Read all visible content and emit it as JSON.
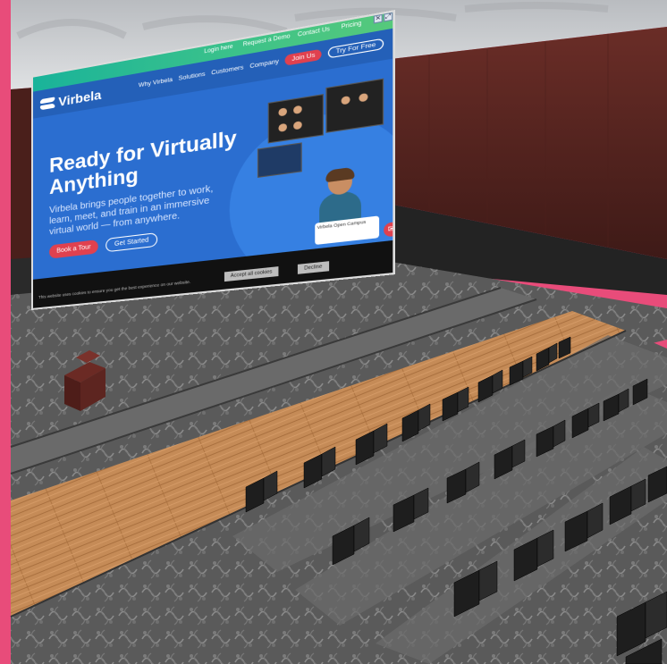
{
  "app": {
    "border_color": "#e84c7a"
  },
  "screen": {
    "topbar_items": [
      "Login here",
      "Request a Demo",
      "Contact Us",
      "Pricing"
    ],
    "logo_text": "Virbela",
    "nav": {
      "links": [
        "Why Virbela",
        "Solutions",
        "Customers",
        "Company"
      ],
      "red_button": "Join Us",
      "outline_button": "Try For Free"
    },
    "hero": {
      "title_line1": "Ready for Virtually",
      "title_line2": "Anything",
      "subtitle": "Virbela brings people together to work, learn, meet, and train in an immersive virtual world — from anywhere.",
      "cta_primary": "Book a Tour",
      "cta_secondary": "Get Started"
    },
    "card_text": "Virbela Open Campus",
    "chat_glyph": "✉",
    "footer": {
      "notice": "This website uses cookies to ensure you get the best experience on our website.",
      "button_left": "Accept all cookies",
      "button_right": "Decline"
    },
    "corner_icons": [
      "✕",
      "⤢"
    ]
  },
  "colors": {
    "wall": "#5a2722",
    "wall_dark": "#3b1816",
    "floor_wood": "#c48a55",
    "carpet": "#5d5d5d",
    "seat": "#1e1e1e",
    "web_blue": "#2b6ed0",
    "web_green": "#19b39a",
    "brand_red": "#e0414f"
  }
}
